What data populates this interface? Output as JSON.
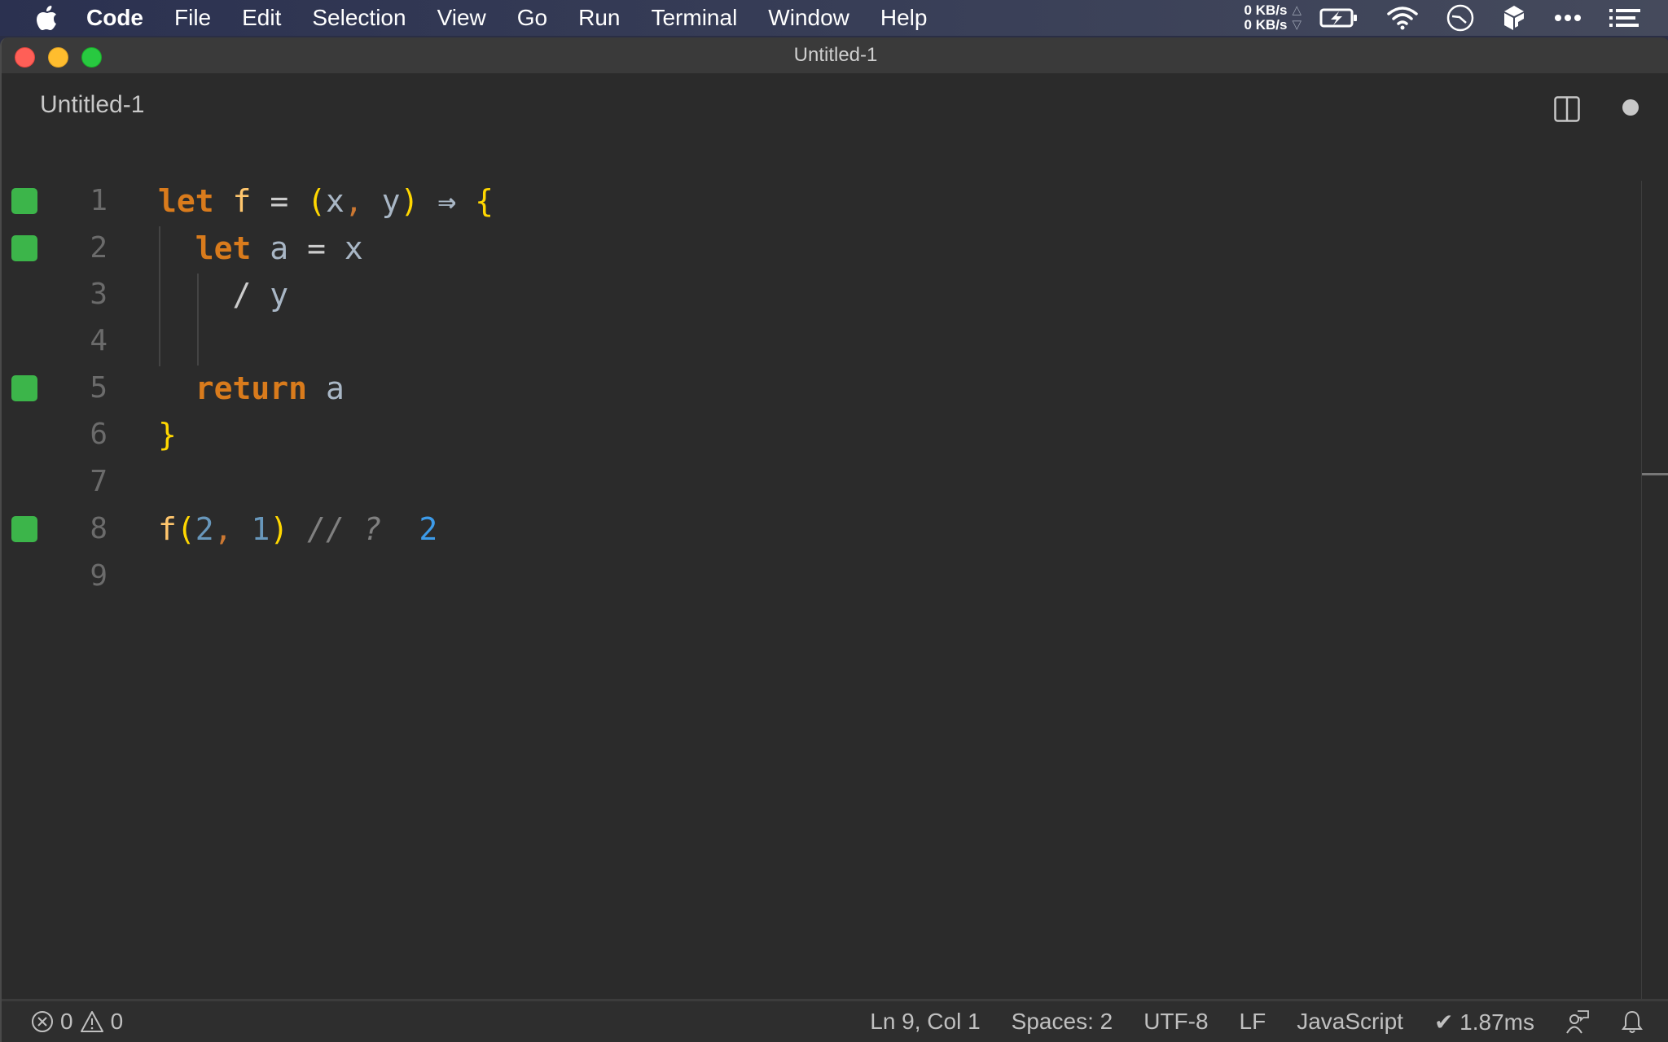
{
  "menubar": {
    "app_name": "Code",
    "items": [
      "File",
      "Edit",
      "Selection",
      "View",
      "Go",
      "Run",
      "Terminal",
      "Window",
      "Help"
    ],
    "net_up": "0 KB/s",
    "net_down": "0 KB/s",
    "tray_icons": [
      "battery-charging-icon",
      "wifi-icon",
      "clock-icon",
      "box-icon",
      "more-icon",
      "list-icon"
    ]
  },
  "window": {
    "title": "Untitled-1"
  },
  "tab": {
    "title": "Untitled-1",
    "dirty": true
  },
  "editor": {
    "lines": [
      {
        "number": "1",
        "marker": true
      },
      {
        "number": "2",
        "marker": true
      },
      {
        "number": "3",
        "marker": false
      },
      {
        "number": "4",
        "marker": false
      },
      {
        "number": "5",
        "marker": true
      },
      {
        "number": "6",
        "marker": false
      },
      {
        "number": "7",
        "marker": false
      },
      {
        "number": "8",
        "marker": true
      },
      {
        "number": "9",
        "marker": false
      }
    ],
    "code": {
      "l1": {
        "let": "let",
        "name": "f",
        "eq": "=",
        "lp": "(",
        "x": "x",
        "comma": ",",
        "y": "y",
        "rp": ")",
        "arrow": "⇒",
        "lb": "{"
      },
      "l2": {
        "let": "let",
        "name": "a",
        "eq": "=",
        "x": "x"
      },
      "l3": {
        "div": "/",
        "y": "y"
      },
      "l5": {
        "ret": "return",
        "a": "a"
      },
      "l6": {
        "rb": "}"
      },
      "l8": {
        "fn": "f",
        "lp": "(",
        "n1": "2",
        "comma": ",",
        "n2": "1",
        "rp": ")",
        "comment": "// ?",
        "result": "2"
      }
    },
    "marker_color": "#3cb54a"
  },
  "statusbar": {
    "errors": "0",
    "warnings": "0",
    "position": "Ln 9, Col 1",
    "spaces": "Spaces: 2",
    "encoding": "UTF-8",
    "eol": "LF",
    "language": "JavaScript",
    "timing": "✔ 1.87ms"
  }
}
